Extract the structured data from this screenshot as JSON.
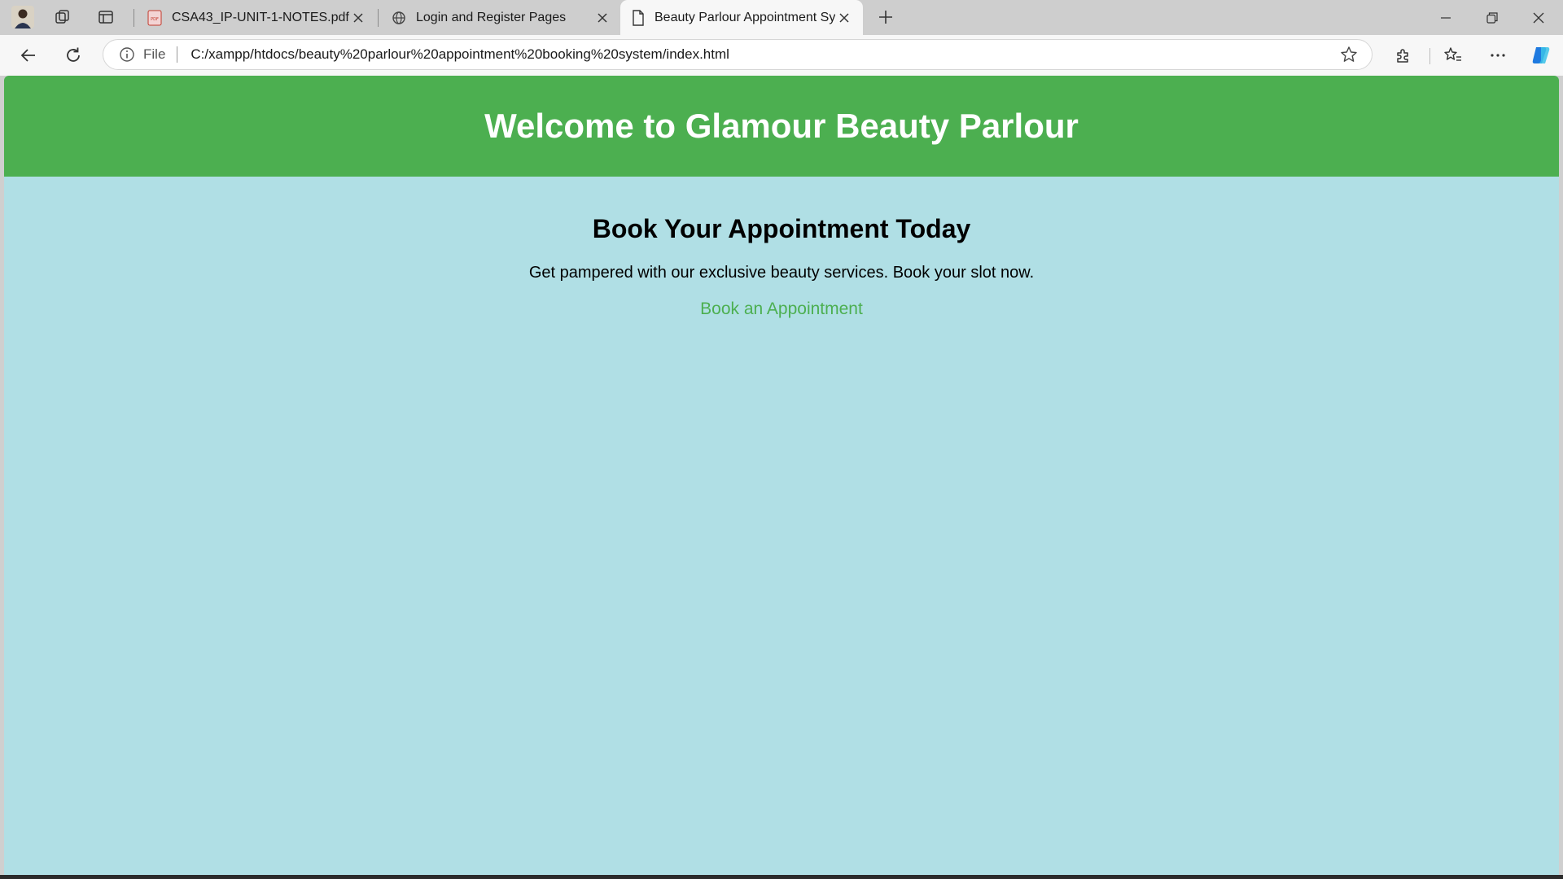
{
  "browser": {
    "tabs": [
      {
        "title": "CSA43_IP-UNIT-1-NOTES.pdf",
        "icon": "pdf-icon",
        "active": false
      },
      {
        "title": "Login and Register Pages",
        "icon": "globe-icon",
        "active": false
      },
      {
        "title": "Beauty Parlour Appointment Syste",
        "icon": "document-icon",
        "active": true
      }
    ],
    "address_bar": {
      "scheme_label": "File",
      "url": "C:/xampp/htdocs/beauty%20parlour%20appointment%20booking%20system/index.html"
    }
  },
  "page": {
    "header_title": "Welcome to Glamour Beauty Parlour",
    "hero_heading": "Book Your Appointment Today",
    "hero_text": "Get pampered with our exclusive beauty services. Book your slot now.",
    "cta_link": "Book an Appointment"
  },
  "colors": {
    "header_bg": "#4caf50",
    "page_bg": "#b0dfe5",
    "link": "#4caf50"
  }
}
